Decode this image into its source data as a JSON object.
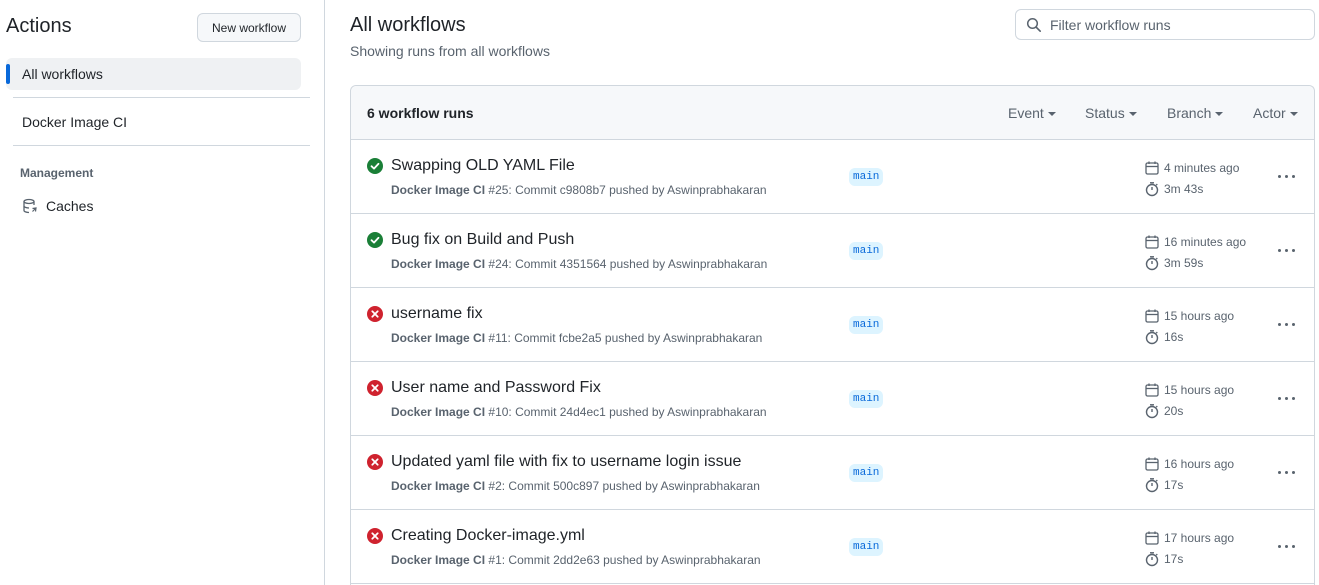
{
  "sidebar": {
    "title": "Actions",
    "new_workflow_label": "New workflow",
    "items": [
      {
        "label": "All workflows",
        "active": true
      },
      {
        "label": "Docker Image CI",
        "active": false
      }
    ],
    "management_label": "Management",
    "caches_label": "Caches",
    "caches_icon": "database-icon"
  },
  "main": {
    "title": "All workflows",
    "subtitle": "Showing runs from all workflows",
    "search": {
      "placeholder": "Filter workflow runs",
      "value": "",
      "icon": "search-icon"
    }
  },
  "runs_header": {
    "count_label": "6 workflow runs",
    "filters": [
      "Event",
      "Status",
      "Branch",
      "Actor"
    ]
  },
  "colors": {
    "success": "#1a7f37",
    "failure": "#cf222e",
    "accent": "#0969da",
    "branch_bg": "#ddf4ff"
  },
  "runs": [
    {
      "status": "success",
      "title": "Swapping OLD YAML File",
      "workflow": "Docker Image CI",
      "meta": "#25: Commit c9808b7 pushed by Aswinprabhakaran",
      "branch": "main",
      "when": "4 minutes ago",
      "duration": "3m 43s"
    },
    {
      "status": "success",
      "title": "Bug fix on Build and Push",
      "workflow": "Docker Image CI",
      "meta": "#24: Commit 4351564 pushed by Aswinprabhakaran",
      "branch": "main",
      "when": "16 minutes ago",
      "duration": "3m 59s"
    },
    {
      "status": "failure",
      "title": "username fix",
      "workflow": "Docker Image CI",
      "meta": "#11: Commit fcbe2a5 pushed by Aswinprabhakaran",
      "branch": "main",
      "when": "15 hours ago",
      "duration": "16s"
    },
    {
      "status": "failure",
      "title": "User name and Password Fix",
      "workflow": "Docker Image CI",
      "meta": "#10: Commit 24d4ec1 pushed by Aswinprabhakaran",
      "branch": "main",
      "when": "15 hours ago",
      "duration": "20s"
    },
    {
      "status": "failure",
      "title": "Updated yaml file with fix to username login issue",
      "workflow": "Docker Image CI",
      "meta": "#2: Commit 500c897 pushed by Aswinprabhakaran",
      "branch": "main",
      "when": "16 hours ago",
      "duration": "17s"
    },
    {
      "status": "failure",
      "title": "Creating Docker-image.yml",
      "workflow": "Docker Image CI",
      "meta": "#1: Commit 2dd2e63 pushed by Aswinprabhakaran",
      "branch": "main",
      "when": "17 hours ago",
      "duration": "17s"
    }
  ]
}
